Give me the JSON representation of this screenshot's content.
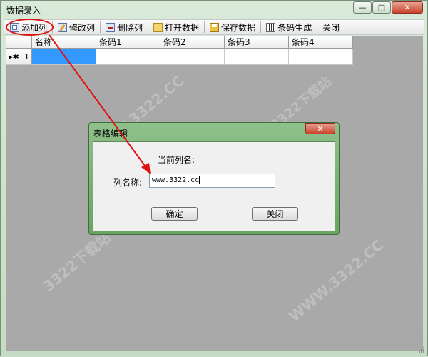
{
  "window": {
    "title": "数据录入",
    "controls": {
      "minimize": "—",
      "maximize": "□",
      "close": "✕"
    }
  },
  "toolbar": {
    "items": [
      {
        "label": "添加列",
        "icon": "add-column-icon"
      },
      {
        "label": "修改列",
        "icon": "edit-column-icon"
      },
      {
        "label": "删除列",
        "icon": "delete-column-icon"
      },
      {
        "label": "打开数据",
        "icon": "open-folder-icon"
      },
      {
        "label": "保存数据",
        "icon": "save-icon"
      },
      {
        "label": "条码生成",
        "icon": "barcode-icon"
      },
      {
        "label": "关闭",
        "icon": ""
      }
    ]
  },
  "grid": {
    "columns": [
      "名称",
      "条码1",
      "条码2",
      "条码3",
      "条码4"
    ],
    "rows": [
      {
        "marker": "▸✱",
        "number": "1",
        "cells": [
          "",
          "",
          "",
          "",
          ""
        ]
      }
    ]
  },
  "dialog": {
    "title": "表格编辑",
    "close_label": "✕",
    "current_column_label": "当前列名:",
    "name_label": "列名称:",
    "name_value": "www.3322.cc",
    "confirm_label": "确定",
    "close_button_label": "关闭"
  },
  "watermark": {
    "text": "WWW.3322.CC",
    "text2": "3322下载站"
  },
  "colors": {
    "highlight": "#e01010",
    "selection": "#3399ff",
    "arrow": "#e01010"
  }
}
